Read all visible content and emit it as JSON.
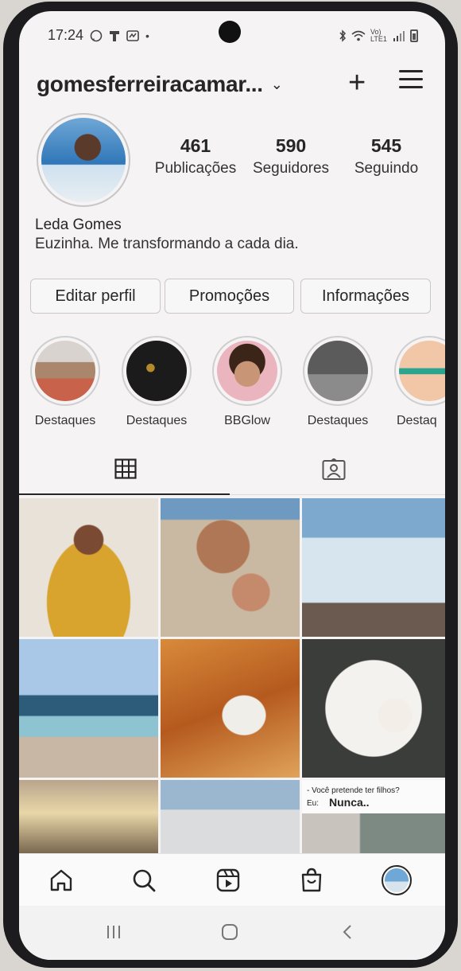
{
  "status_bar": {
    "time": "17:24",
    "dot": "•",
    "network": "Vo) LTE1"
  },
  "header": {
    "username": "gomesferreiracamar...",
    "chevron": "⌄"
  },
  "stats": [
    {
      "value": "461",
      "label": "Publicações"
    },
    {
      "value": "590",
      "label": "Seguidores"
    },
    {
      "value": "545",
      "label": "Seguindo"
    }
  ],
  "profile": {
    "name": "Leda Gomes",
    "bio": "Euzinha. Me transformando a cada dia."
  },
  "buttons": {
    "edit": "Editar perfil",
    "promos": "Promoções",
    "info": "Informações"
  },
  "highlights": [
    {
      "label": "Destaques"
    },
    {
      "label": "Destaques"
    },
    {
      "label": "BBGlow"
    },
    {
      "label": "Destaques"
    },
    {
      "label": "Destaq"
    }
  ],
  "grid_texts": {
    "question": "- Você pretende ter filhos?",
    "eu": "Eu:",
    "answer": "Nunca.."
  },
  "nav_icons": [
    "home-icon",
    "search-icon",
    "reels-icon",
    "shop-icon",
    "profile-avatar"
  ]
}
